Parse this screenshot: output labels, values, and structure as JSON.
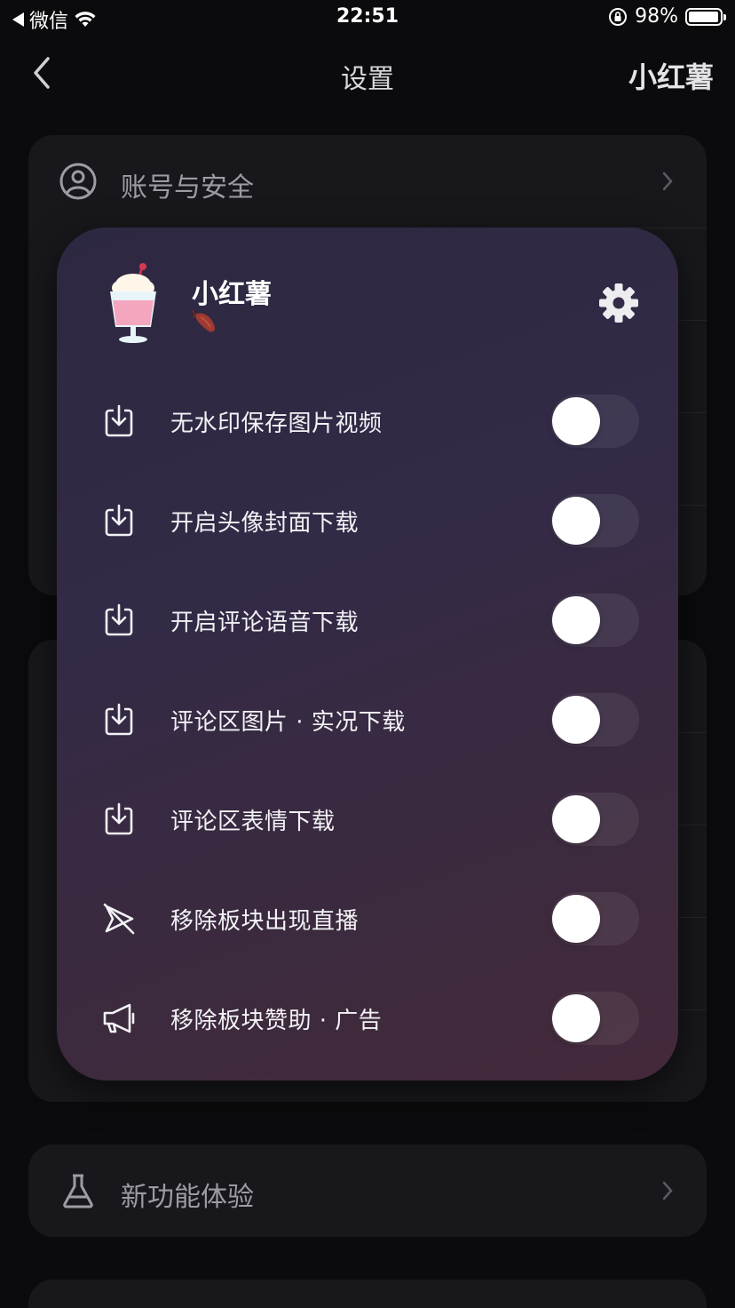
{
  "status_bar": {
    "back_app": "微信",
    "time": "22:51",
    "battery": "98%",
    "battery_level": 0.98
  },
  "nav": {
    "title": "设置",
    "right_label": "小红薯"
  },
  "background_rows": {
    "account": "账号与安全",
    "new_features": "新功能体验"
  },
  "panel": {
    "app_name": "小红薯",
    "options": [
      {
        "label": "无水印保存图片视频",
        "icon": "download-icon",
        "enabled": false
      },
      {
        "label": "开启头像封面下载",
        "icon": "download-icon",
        "enabled": false
      },
      {
        "label": "开启评论语音下载",
        "icon": "download-icon",
        "enabled": false
      },
      {
        "label": "评论区图片 · 实况下载",
        "icon": "download-icon",
        "enabled": false
      },
      {
        "label": "评论区表情下载",
        "icon": "download-icon",
        "enabled": false
      },
      {
        "label": "移除板块出现直播",
        "icon": "send-off-icon",
        "enabled": false
      },
      {
        "label": "移除板块赞助 · 广告",
        "icon": "megaphone-icon",
        "enabled": false
      }
    ]
  }
}
